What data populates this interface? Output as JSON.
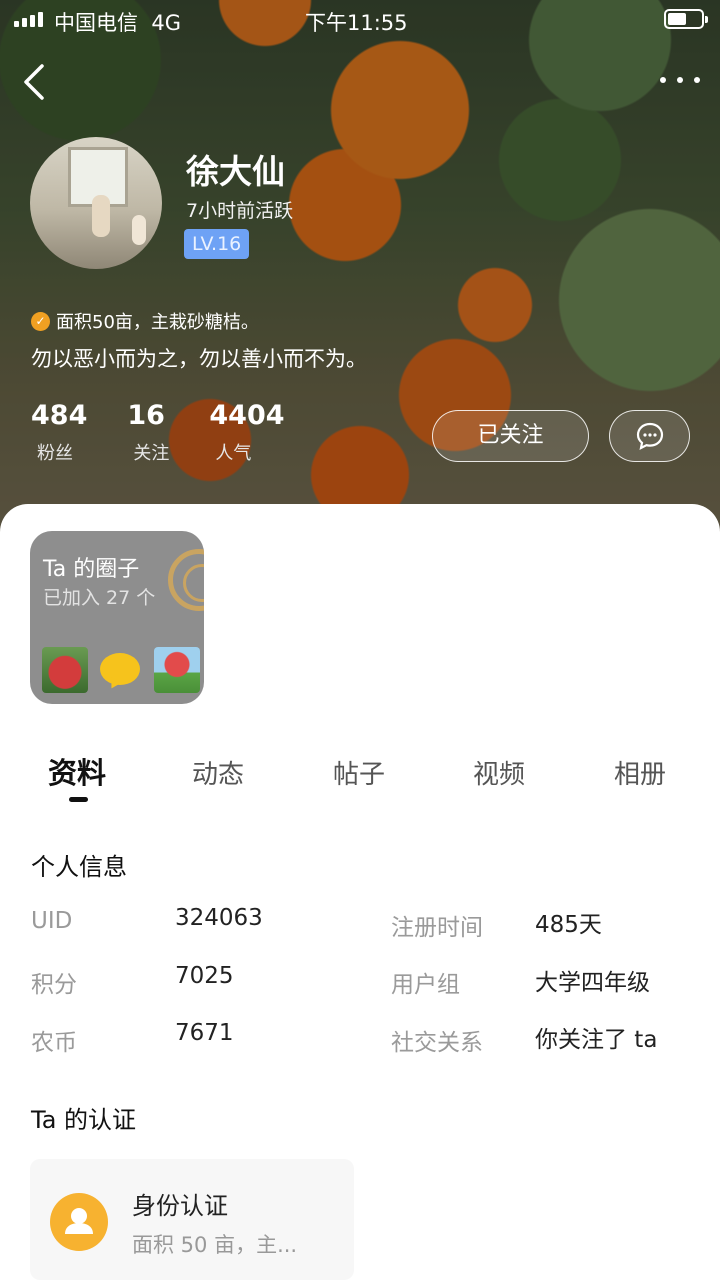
{
  "status_bar": {
    "carrier": "中国电信",
    "network": "4G",
    "time": "下午11:55"
  },
  "profile": {
    "name": "徐大仙",
    "active_time": "7小时前活跃",
    "level": "LV.16",
    "certification": "面积50亩，主栽砂糖桔。",
    "motto": "勿以恶小而为之，勿以善小而不为。",
    "stats": [
      {
        "value": "484",
        "label": "粉丝"
      },
      {
        "value": "16",
        "label": "关注"
      },
      {
        "value": "4404",
        "label": "人气"
      }
    ],
    "follow_label": "已关注"
  },
  "circles": {
    "title": "Ta 的圈子",
    "joined": "已加入 27 个"
  },
  "tabs": [
    "资料",
    "动态",
    "帖子",
    "视频",
    "相册"
  ],
  "personal_info": {
    "title": "个人信息",
    "rows": [
      {
        "label": "UID",
        "value": "324063"
      },
      {
        "label": "积分",
        "value": "7025"
      },
      {
        "label": "农币",
        "value": "7671"
      },
      {
        "label": "注册时间",
        "value": "485天"
      },
      {
        "label": "用户组",
        "value": "大学四年级"
      },
      {
        "label": "社交关系",
        "value": "你关注了 ta"
      }
    ]
  },
  "certification_section": {
    "title": "Ta 的认证",
    "card_title": "身份认证",
    "card_desc": "面积 50 亩，主..."
  },
  "colors": {
    "level_badge": "#6ea2f5",
    "cert_icon": "#f7b230"
  }
}
